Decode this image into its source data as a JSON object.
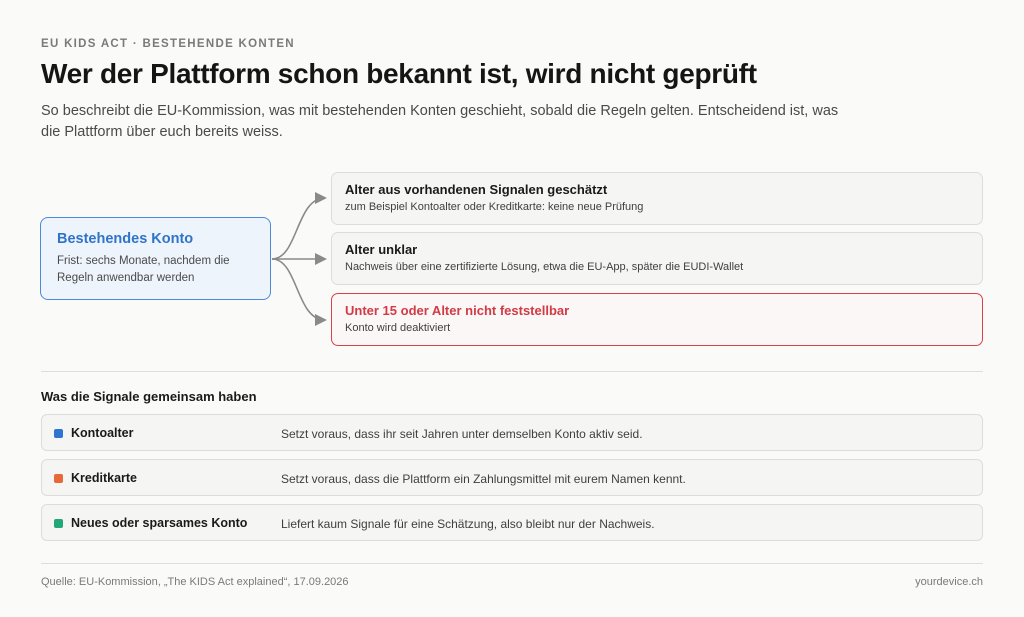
{
  "header": {
    "eyebrow": "EU KIDS ACT · BESTEHENDE KONTEN",
    "title": "Wer der Plattform schon bekannt ist, wird nicht geprüft",
    "subtitle": "So beschreibt die EU-Kommission, was mit bestehenden Konten geschieht, sobald die Regeln gelten. Entscheidend ist, was die Plattform über euch bereits weiss."
  },
  "source": {
    "title": "Bestehendes Konto",
    "description": "Frist: sechs Monate, nachdem die Regeln anwendbar werden"
  },
  "outcomes": [
    {
      "title": "Alter aus vorhandenen Signalen geschätzt",
      "description": "zum Beispiel Kontoalter oder Kreditkarte: keine neue Prüfung"
    },
    {
      "title": "Alter unklar",
      "description": "Nachweis über eine zertifizierte Lösung, etwa die EU-App, später die EUDI-Wallet"
    },
    {
      "title": "Unter 15 oder Alter nicht feststellbar",
      "description": "Konto wird deaktiviert"
    }
  ],
  "signals": {
    "heading": "Was die Signale gemeinsam haben",
    "items": [
      {
        "name": "Kontoalter",
        "description": "Setzt voraus, dass ihr seit Jahren unter demselben Konto aktiv seid.",
        "color": "#2f74d0"
      },
      {
        "name": "Kreditkarte",
        "description": "Setzt voraus, dass die Plattform ein Zahlungsmittel mit eurem Namen kennt.",
        "color": "#e8683a"
      },
      {
        "name": "Neues oder sparsames Konto",
        "description": "Liefert kaum Signale für eine Schätzung, also bleibt nur der Nachweis.",
        "color": "#23a67a"
      }
    ]
  },
  "footer": {
    "source": "Quelle: EU-Kommission, „The KIDS Act explained“, 17.09.2026",
    "brand": "yourdevice.ch"
  },
  "colors": {
    "accent": "#2f74c9",
    "danger": "#d23a45",
    "connector": "#8a8a88"
  }
}
